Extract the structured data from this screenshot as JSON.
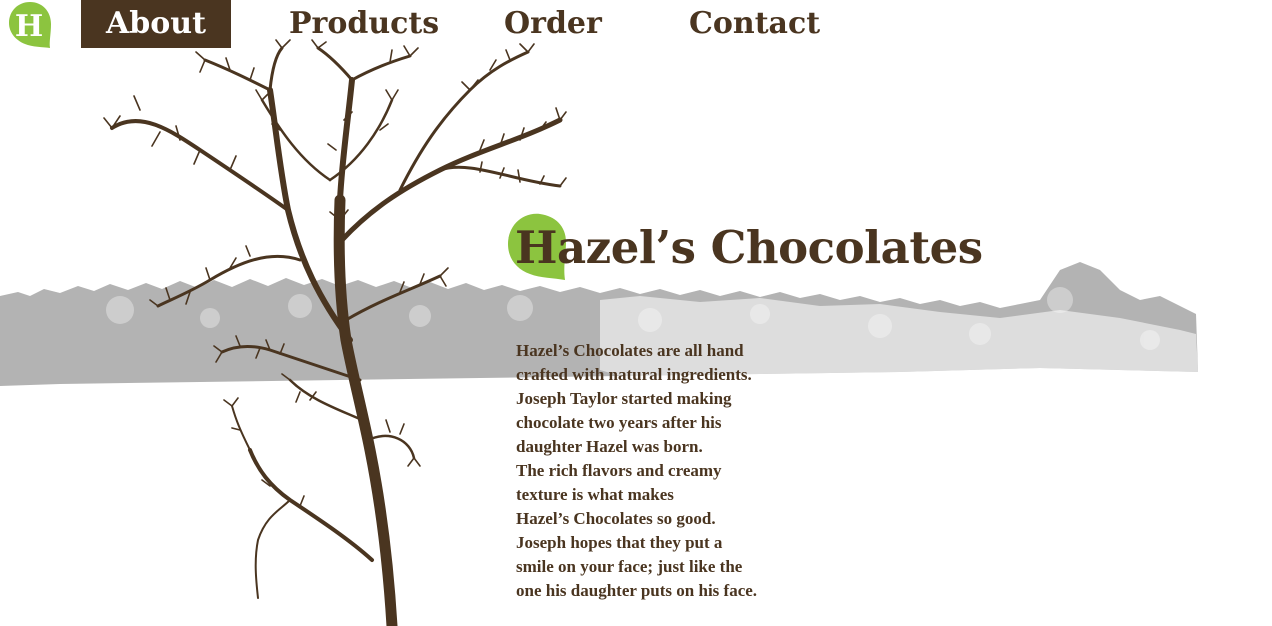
{
  "nav": {
    "logo_letter": "H",
    "items": [
      {
        "label": "About",
        "active": true
      },
      {
        "label": "Products",
        "active": false
      },
      {
        "label": "Order",
        "active": false
      },
      {
        "label": "Contact",
        "active": false
      }
    ]
  },
  "main": {
    "title": "Hazel’s Chocolates",
    "paragraph_lines": [
      "Hazel’s Chocolates are all hand",
      "crafted with natural ingredients.",
      "Joseph Taylor started making",
      "chocolate two years after his",
      "daughter Hazel was born.",
      "The rich flavors and creamy",
      "texture is what makes",
      "Hazel’s Chocolates so good.",
      "Joseph hopes that they put a",
      "smile on your face; just like the",
      "one his daughter puts on his face."
    ]
  },
  "colors": {
    "brown": "#4a3520",
    "leaf_green": "#8cc43f",
    "treeline_gray": "#b5b5b5",
    "white": "#ffffff"
  },
  "icons": {
    "logo": "leaf-h-logo-icon",
    "tree": "bare-tree-illustration",
    "treeline": "treeline-silhouette"
  }
}
